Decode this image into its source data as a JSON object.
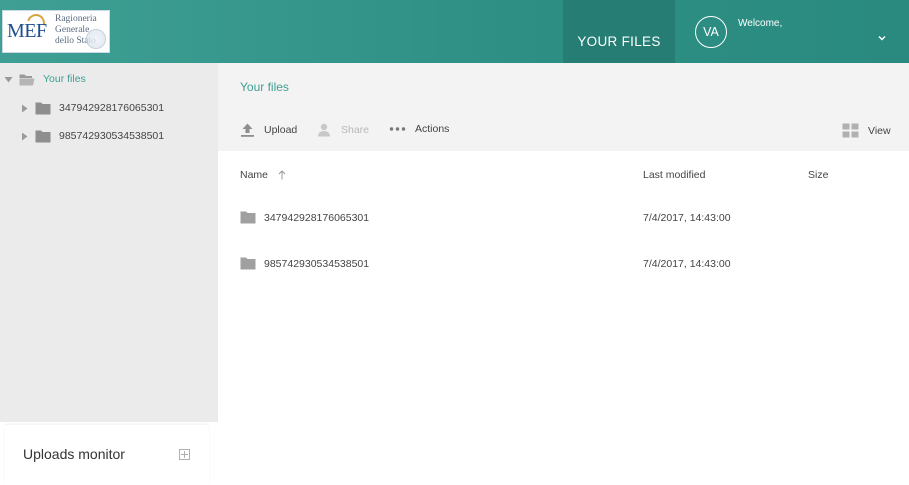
{
  "header": {
    "logo": {
      "abbr": "MEF",
      "line1": "Ragioneria",
      "line2": "Generale",
      "line3": "dello Stato"
    },
    "nav_files_label": "YOUR FILES",
    "avatar_initials": "VA",
    "welcome_text": "Welcome,",
    "accent_color": "#2d8f84"
  },
  "sidebar": {
    "root_label": "Your files",
    "items": [
      {
        "label": "347942928176065301"
      },
      {
        "label": "985742930534538501"
      }
    ],
    "uploads_monitor_label": "Uploads monitor"
  },
  "main": {
    "breadcrumb": "Your files",
    "toolbar": {
      "upload_label": "Upload",
      "share_label": "Share",
      "actions_label": "Actions",
      "view_label": "View"
    },
    "columns": {
      "name": "Name",
      "last_modified": "Last modified",
      "size": "Size"
    },
    "rows": [
      {
        "name": "347942928176065301",
        "last_modified": "7/4/2017, 14:43:00",
        "size": ""
      },
      {
        "name": "985742930534538501",
        "last_modified": "7/4/2017, 14:43:00",
        "size": ""
      }
    ]
  }
}
